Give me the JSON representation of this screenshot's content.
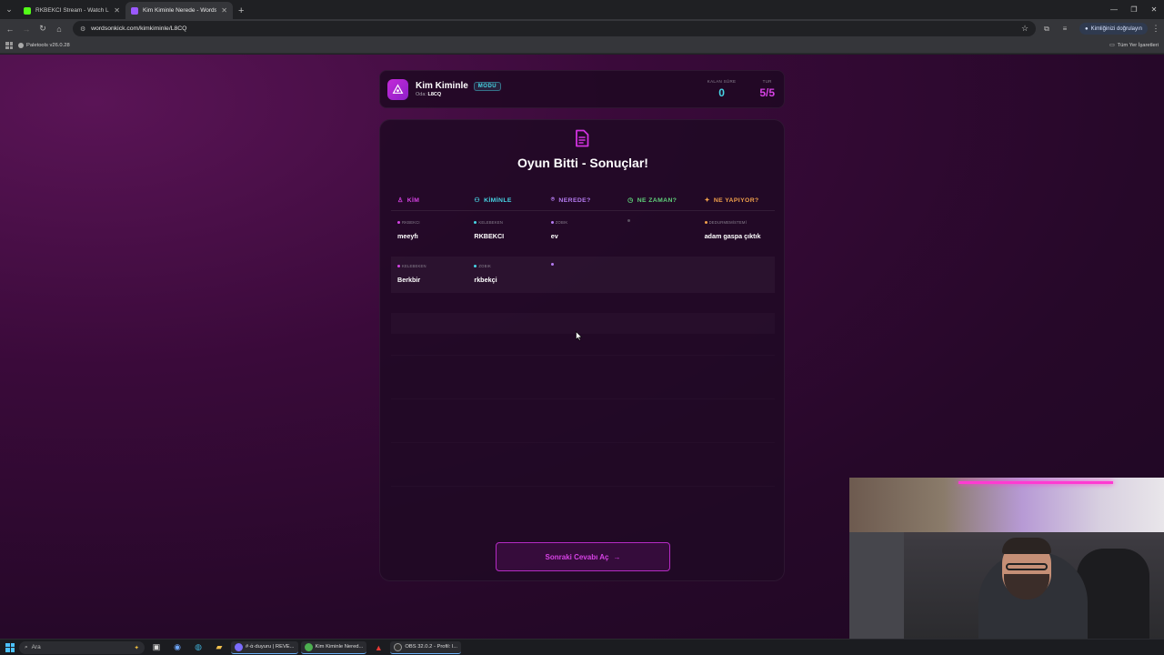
{
  "browser": {
    "tabs": [
      {
        "title": "RKBEKCI Stream - Watch Live o",
        "favicon_color": "#53fc18",
        "active": false
      },
      {
        "title": "Kim Kiminle Nerede - Words O",
        "favicon_color": "#9b59ff",
        "active": true
      }
    ],
    "address": "wordsonkick.com/kimkiminle/L8CQ",
    "profile_label": "Kimliğinizi doğrulayın",
    "bookmarks": [
      {
        "label": "Paletools v26.0.28"
      }
    ],
    "bookmarks_right": "Tüm Yer İşaretleri"
  },
  "game": {
    "title": "Kim Kiminle",
    "mode_badge": "MODU",
    "room_label": "Oda:",
    "room_code": "L8CQ",
    "stats": [
      {
        "label": "KALAN SÜRE",
        "value": "0",
        "color": "#47d6e6"
      },
      {
        "label": "TUR",
        "value": "5/5",
        "color": "#d642e4"
      }
    ],
    "heading": "Oyun Bitti - Sonuçlar!",
    "columns": [
      {
        "label": "KİM",
        "icon": "person-icon",
        "color": "#d642e4"
      },
      {
        "label": "KİMİNLE",
        "icon": "people-icon",
        "color": "#47d6e6"
      },
      {
        "label": "NEREDE?",
        "icon": "pin-icon",
        "color": "#b57cf2"
      },
      {
        "label": "NE ZAMAN?",
        "icon": "clock-icon",
        "color": "#5fd27a"
      },
      {
        "label": "NE YAPIYOR?",
        "icon": "running-icon",
        "color": "#f0a04b"
      }
    ],
    "rows": [
      {
        "cells": [
          {
            "tag": "RKBEKCI",
            "value": "meeyfı"
          },
          {
            "tag": "KELEBEKEN",
            "value": "RKBEKCI"
          },
          {
            "tag": "ZOBIK",
            "value": "ev"
          },
          {
            "tag": "",
            "value": ""
          },
          {
            "tag": "DEDURMEMİSTEMİ",
            "value": "adam gaspa çıktık"
          }
        ]
      },
      {
        "cells": [
          {
            "tag": "KELEBEKEN",
            "value": "Berkbir"
          },
          {
            "tag": "ZOBIK",
            "value": "rkbekçi"
          },
          {
            "tag": "",
            "value": ""
          },
          {
            "tag": "",
            "value": ""
          },
          {
            "tag": "",
            "value": ""
          }
        ]
      }
    ],
    "next_button": "Sonraki Cevabı Aç"
  },
  "taskbar": {
    "search_placeholder": "Ara",
    "apps": [
      {
        "label": "#·ά·duyuru | REVE...",
        "color": "#7b6cff"
      },
      {
        "label": "Kim Kiminle Nered...",
        "color": "#4caf50"
      },
      {
        "label": "OBS 32.0.2 - Profil: l...",
        "color": "#333333"
      }
    ]
  }
}
